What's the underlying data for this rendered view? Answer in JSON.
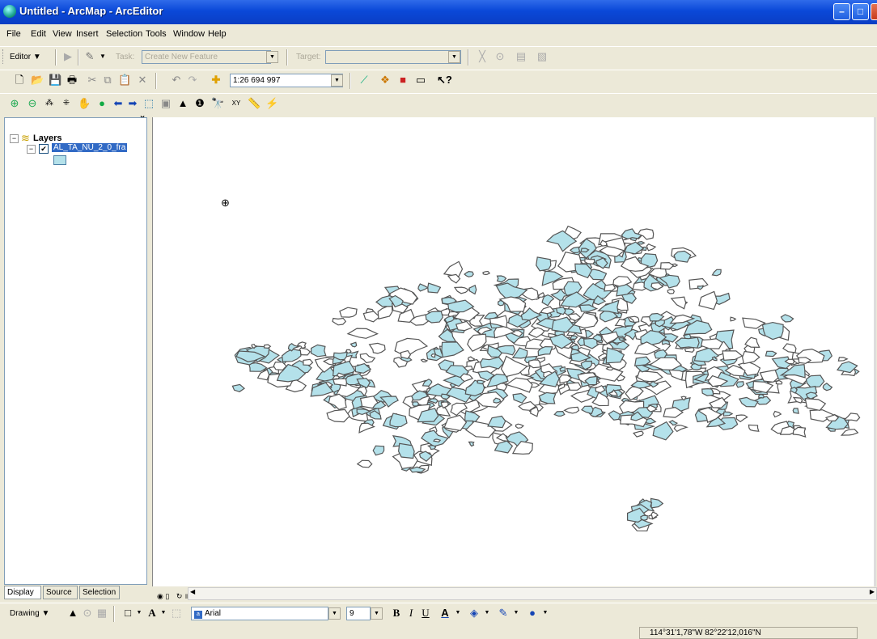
{
  "window": {
    "title": "Untitled - ArcMap - ArcEditor",
    "min_label": "–",
    "max_label": "□",
    "close_label": "✕"
  },
  "menu": [
    "File",
    "Edit",
    "View",
    "Insert",
    "Selection",
    "Tools",
    "Window",
    "Help"
  ],
  "editor_toolbar": {
    "editor_label": "Editor ▼",
    "task_label": "Task:",
    "task_value": "Create New Feature",
    "target_label": "Target:",
    "target_value": ""
  },
  "standard_toolbar": {
    "scale_value": "1:26 694 997"
  },
  "toc": {
    "root_label": "Layers",
    "layer_name": "AL_TA_NU_2_0_fra",
    "layer_checked": true,
    "close_label": "×",
    "tabs": [
      "Display",
      "Source",
      "Selection"
    ],
    "fill_color": "#B4E1EA"
  },
  "drawing_toolbar": {
    "drawing_label": "Drawing ▼",
    "font_value": "Arial",
    "size_value": "9",
    "bold_label": "B",
    "italic_label": "I",
    "underline_label": "U"
  },
  "status": {
    "coordinates": "114°31'1,78\"W  82°22'12,016\"N"
  },
  "map": {
    "polygon_fill": "#B4E1EA",
    "polygon_outline": "#555555"
  }
}
